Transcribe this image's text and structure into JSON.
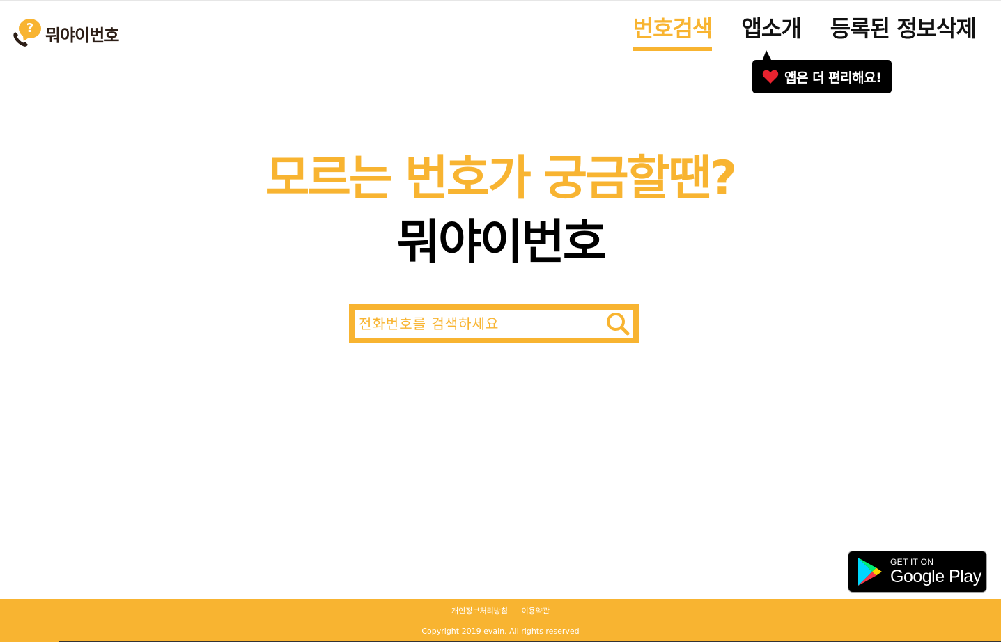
{
  "header": {
    "logo_text": "뭐야이번호",
    "logo_bubble_glyph": "?",
    "nav": [
      {
        "label": "번호검색",
        "active": true
      },
      {
        "label": "앱소개",
        "active": false
      },
      {
        "label": "등록된 정보삭제",
        "active": false
      }
    ],
    "tooltip": {
      "icon": "heart-icon",
      "text": "앱은 더 편리해요!"
    }
  },
  "hero": {
    "line1": "모르는 번호가 궁금할땐?",
    "line2": "뭐야이번호"
  },
  "search": {
    "placeholder": "전화번호를 검색하세요",
    "value": "",
    "icon": "search-icon"
  },
  "play_badge": {
    "small_text": "GET IT ON",
    "big_text": "Google Play"
  },
  "footer": {
    "links": [
      "개인정보처리방침",
      "이용약관"
    ],
    "copyright": "Copyright 2019 evain. All rights reserved"
  },
  "colors": {
    "accent": "#f8b431",
    "text_dark": "#111111",
    "logo_text": "#2c1e16",
    "heart": "#e8232f"
  }
}
